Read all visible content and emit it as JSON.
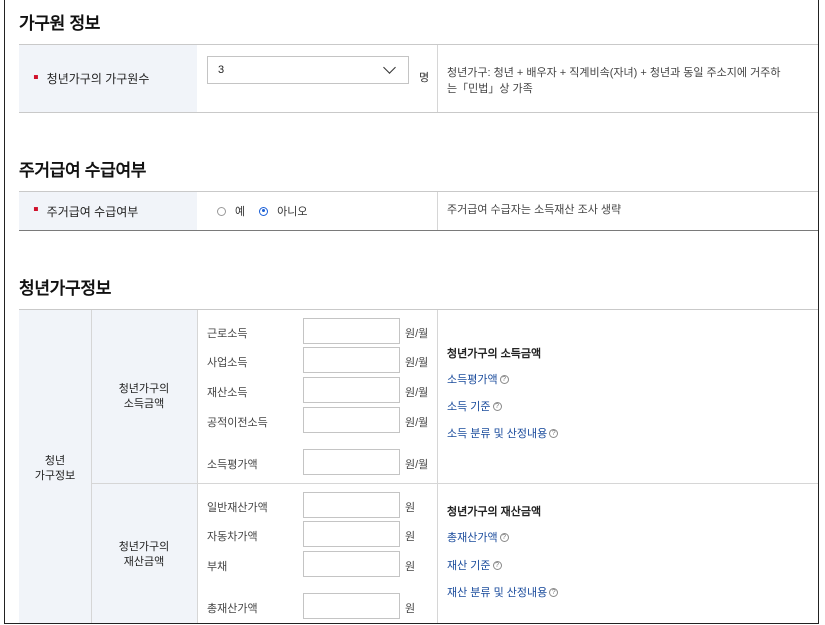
{
  "household": {
    "title": "가구원 정보",
    "label": "청년가구의 가구원수",
    "selected": "3",
    "unit": "명",
    "note_line1": "청년가구: 청년 + 배우자 + 직계비속(자녀) + 청년과 동일 주소지에 거주하",
    "note_line2": "는「민법」상 가족"
  },
  "housing": {
    "title": "주거급여 수급여부",
    "label": "주거급여 수급여부",
    "opt_yes": "예",
    "opt_no": "아니오",
    "selected": "아니오",
    "note": "주거급여 수급자는 소득재산 조사 생략"
  },
  "youth": {
    "title": "청년가구정보",
    "side_line1": "청년",
    "side_line2": "가구정보",
    "income": {
      "cat_line1": "청년가구의",
      "cat_line2": "소득금액",
      "fields": [
        {
          "label": "근로소득",
          "unit": "원/월"
        },
        {
          "label": "사업소득",
          "unit": "원/월"
        },
        {
          "label": "재산소득",
          "unit": "원/월"
        },
        {
          "label": "공적이전소득",
          "unit": "원/월"
        },
        {
          "label": "소득평가액",
          "unit": "원/월"
        }
      ],
      "info_title": "청년가구의 소득금액",
      "links": [
        "소득평가액",
        "소득 기준",
        "소득 분류 및 산정내용"
      ]
    },
    "asset": {
      "cat_line1": "청년가구의",
      "cat_line2": "재산금액",
      "fields": [
        {
          "label": "일반재산가액",
          "unit": "원"
        },
        {
          "label": "자동차가액",
          "unit": "원"
        },
        {
          "label": "부채",
          "unit": "원"
        },
        {
          "label": "총재산가액",
          "unit": "원"
        }
      ],
      "info_title": "청년가구의 재산금액",
      "links": [
        "총재산가액",
        "재산 기준",
        "재산 분류 및 산정내용"
      ]
    }
  },
  "colors": {
    "required": "#d0112b",
    "link": "#1a4b9c",
    "label_bg": "#f1f4f9",
    "radio": "#1a5fd6"
  },
  "icons": {
    "dropdown": "chevron-down-icon",
    "help": "question-circle-icon",
    "required": "required-marker-icon"
  }
}
